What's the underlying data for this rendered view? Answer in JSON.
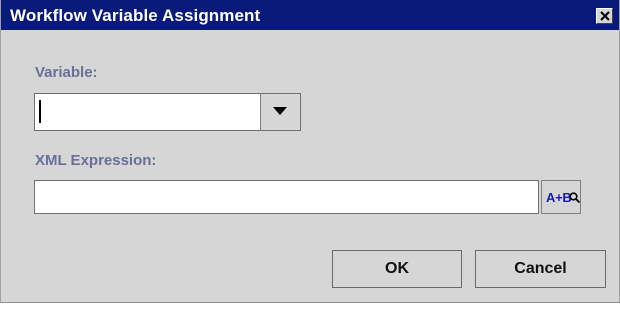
{
  "dialog": {
    "title": "Workflow Variable Assignment",
    "close_icon": "close-icon"
  },
  "variable": {
    "label": "Variable:",
    "value": "",
    "dropdown_icon": "chevron-down-icon"
  },
  "expression": {
    "label": "XML Expression:",
    "value": "",
    "builder_label": "A+B",
    "builder_icon": "magnifier-icon"
  },
  "buttons": {
    "ok_label": "OK",
    "cancel_label": "Cancel"
  },
  "colors": {
    "titlebar": "#0a1a7a",
    "label_text": "#6a6f9a",
    "dialog_bg": "#d6d6d6",
    "builder_text": "#1a1ab0"
  }
}
